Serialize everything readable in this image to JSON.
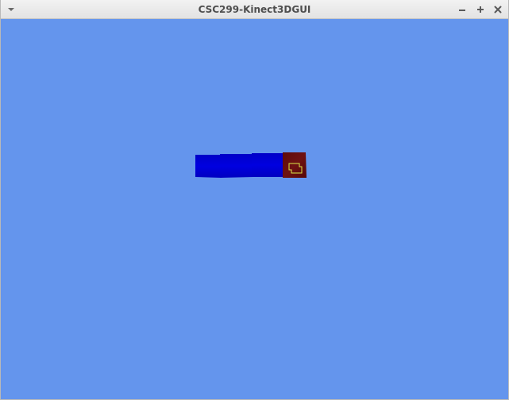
{
  "window": {
    "title": "CSC299-Kinect3DGUI"
  },
  "controls": {
    "menu_icon": "chevron-down-icon",
    "minimize_icon": "minimize-icon",
    "maximize_icon": "maximize-icon",
    "close_icon": "close-icon"
  },
  "scene": {
    "background_color": "#6495ed",
    "bar_color": "#0000d8",
    "cube_color": "#6b0f0f",
    "cursor_color": "#d9e84a"
  }
}
